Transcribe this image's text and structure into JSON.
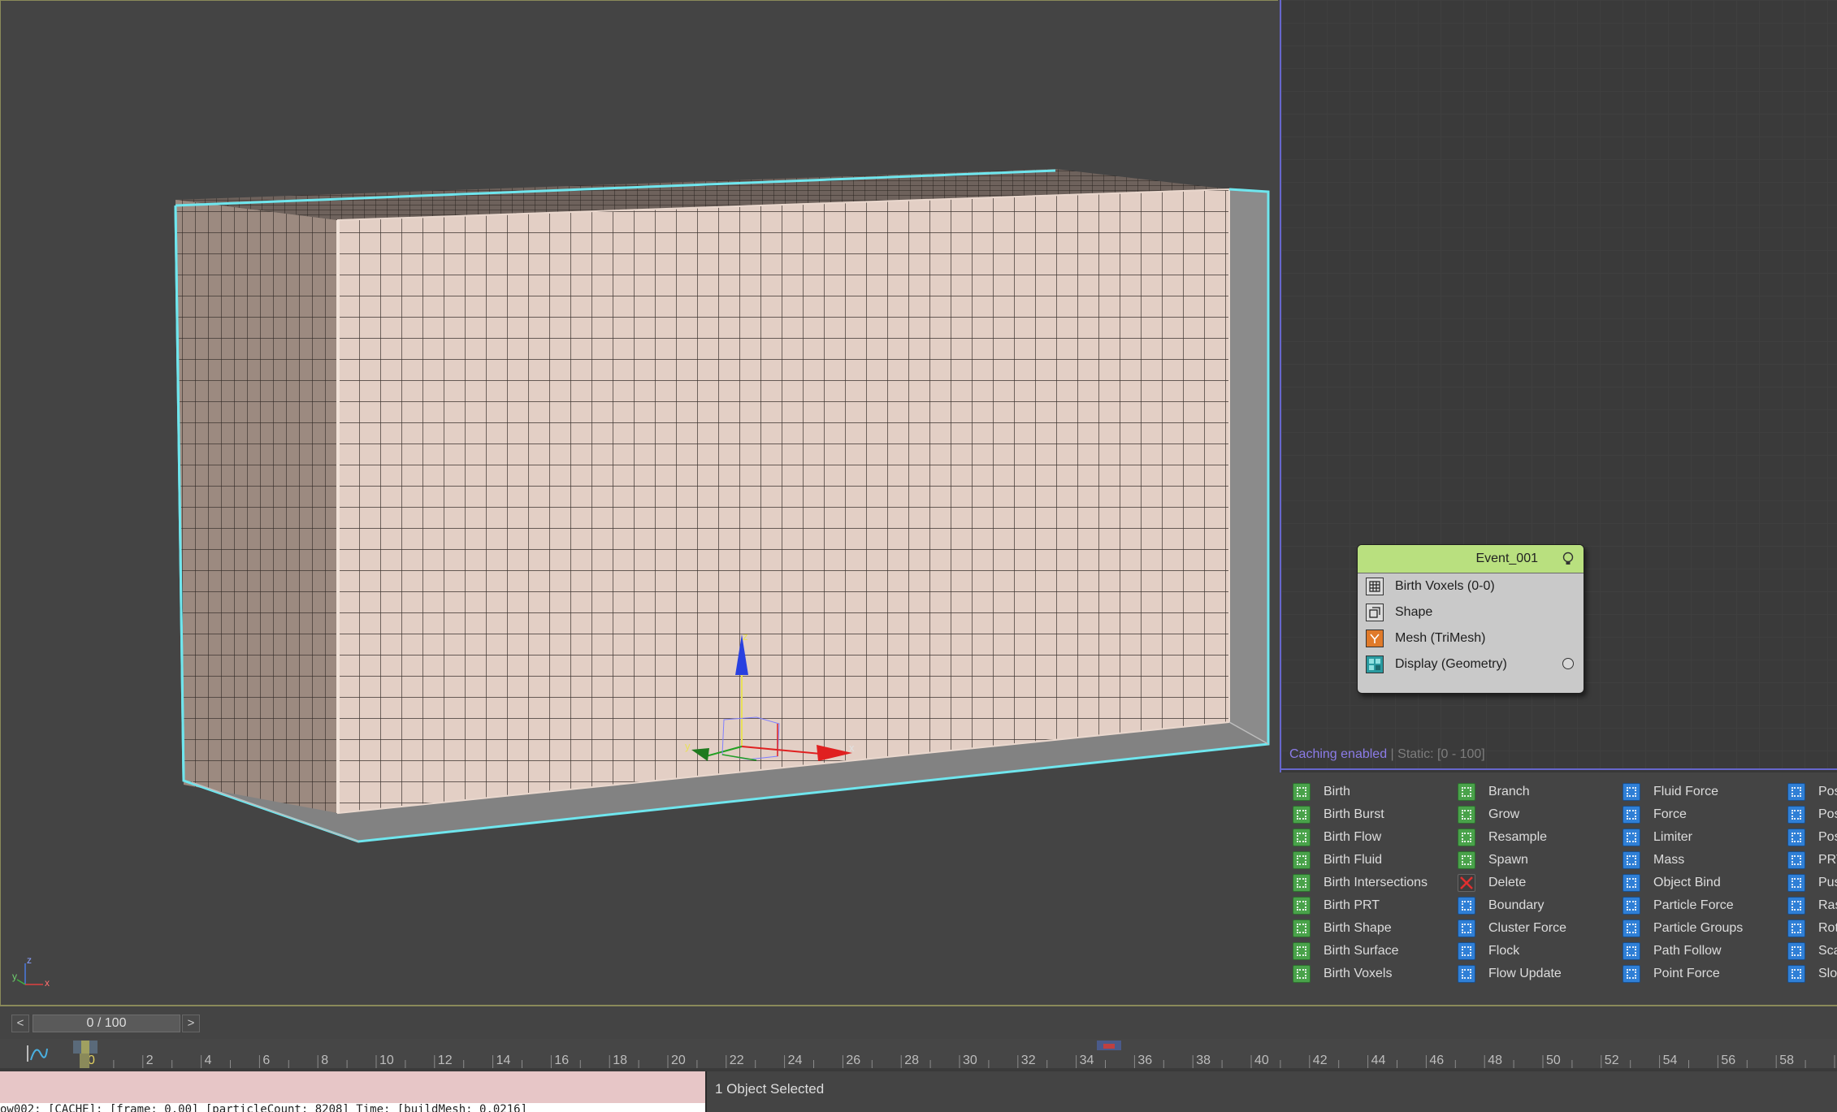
{
  "viewport": {
    "gizmo": {
      "x_label": "x",
      "y_label": "y",
      "z_label": "z"
    },
    "corner_axis": {
      "x_label": "x",
      "y_label": "y",
      "z_label": "z"
    }
  },
  "flow": {
    "status_caching": "Caching enabled",
    "status_sep": " | ",
    "status_static": "Static: [0 - 100]",
    "event": {
      "title": "Event_001",
      "operators": [
        {
          "label": "Birth Voxels (0-0)",
          "icon": "birth-voxels-icon"
        },
        {
          "label": "Shape",
          "icon": "shape-icon"
        },
        {
          "label": "Mesh (TriMesh)",
          "icon": "mesh-icon"
        },
        {
          "label": "Display (Geometry)",
          "icon": "display-icon"
        }
      ]
    }
  },
  "depot": {
    "col1": [
      "Birth",
      "Birth Burst",
      "Birth Flow",
      "Birth Fluid",
      "Birth Intersections",
      "Birth PRT",
      "Birth Shape",
      "Birth Surface",
      "Birth Voxels"
    ],
    "col2": [
      "Branch",
      "Grow",
      "Resample",
      "Spawn",
      "Delete",
      "Boundary",
      "Cluster Force",
      "Flock",
      "Flow Update"
    ],
    "col3": [
      "Fluid Force",
      "Force",
      "Limiter",
      "Mass",
      "Object Bind",
      "Particle Force",
      "Particle Groups",
      "Path Follow",
      "Point Force"
    ],
    "col4": [
      "Pos",
      "Pos",
      "Pos",
      "PRT",
      "Pus",
      "Ras",
      "Rot",
      "Sca",
      "Slo"
    ]
  },
  "time_slider": {
    "prev": "<",
    "next": ">",
    "value": "0 / 100"
  },
  "timeline": {
    "ticks": [
      "0",
      "2",
      "4",
      "6",
      "8",
      "10",
      "12",
      "14",
      "16",
      "18",
      "20",
      "22",
      "24",
      "26",
      "28",
      "30",
      "32",
      "34",
      "36",
      "38",
      "40",
      "42",
      "44",
      "46",
      "48",
      "50",
      "52",
      "54",
      "56",
      "58",
      "6"
    ]
  },
  "statusbar": {
    "listener_output": "ow002: [CACHE]: [frame: 0.00] [particleCount: 8208] Time: [buildMesh: 0.0216]",
    "selection": "1 Object Selected"
  }
}
